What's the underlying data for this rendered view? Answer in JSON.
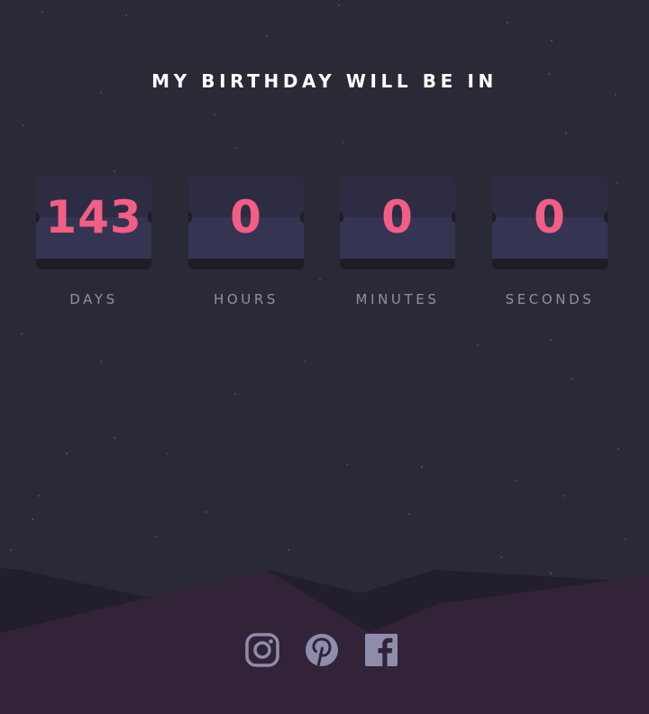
{
  "title": "MY BIRTHDAY WILL BE IN",
  "countdown": [
    {
      "label": "DAYS",
      "value": "143"
    },
    {
      "label": "HOURS",
      "value": "0"
    },
    {
      "label": "MINUTES",
      "value": "0"
    },
    {
      "label": "SECONDS",
      "value": "0"
    }
  ],
  "social": [
    {
      "icon": "instagram-icon"
    },
    {
      "icon": "pinterest-icon"
    },
    {
      "icon": "facebook-icon"
    }
  ],
  "colors": {
    "background": "#2a2a36",
    "accent": "#f15e86",
    "label": "#8f8dab",
    "card_top": "#2d2c42",
    "card_bottom": "#353452",
    "hill_dark": "#231e2b",
    "hill_front": "#322339",
    "icon": "#8f8dab"
  }
}
